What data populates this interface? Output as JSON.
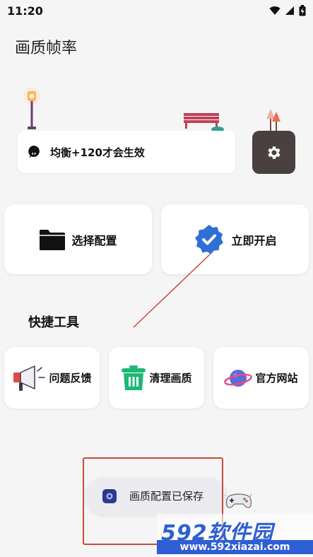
{
  "status_bar": {
    "time": "11:20",
    "icons": [
      "wifi-icon",
      "cellular-icon",
      "battery-charging-icon"
    ]
  },
  "app": {
    "title": "画质帧率"
  },
  "hint": {
    "icon": "hint-bubble-icon",
    "text": "均衡+120才会生效"
  },
  "settings": {
    "icon": "gear-icon"
  },
  "main_actions": [
    {
      "label": "选择配置",
      "icon": "folder-icon"
    },
    {
      "label": "立即开启",
      "icon": "verified-badge-icon",
      "accent": "#2f6fd6"
    }
  ],
  "tools": {
    "title": "快捷工具",
    "items": [
      {
        "label": "问题反馈",
        "icon": "megaphone-icon",
        "accent": "#e04848"
      },
      {
        "label": "清理画质",
        "icon": "trash-can-icon",
        "accent": "#1db874"
      },
      {
        "label": "官方网站",
        "icon": "planet-icon",
        "accent": "#5b6bd8"
      }
    ]
  },
  "toast": {
    "text": "画质配置已保存",
    "icon": "app-icon"
  },
  "watermark": {
    "brand": "592软件园",
    "url": "www.592xiazai.com",
    "color": "#2f5fd3"
  },
  "annotation_color": "#c84a3a"
}
